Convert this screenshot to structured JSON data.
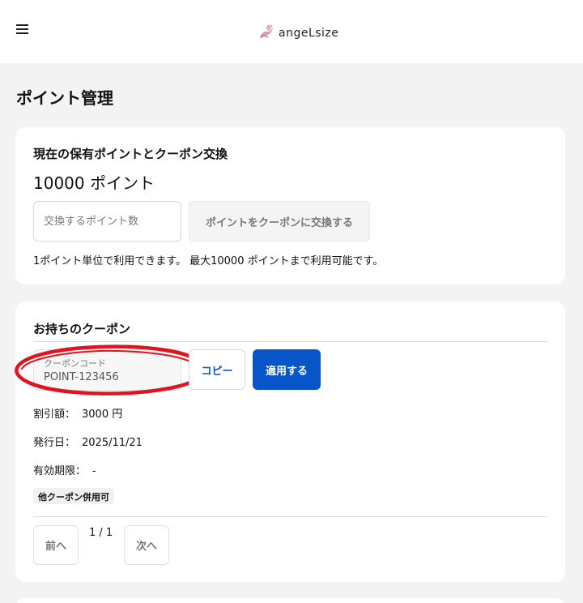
{
  "header": {
    "menu_icon": "hamburger-menu-icon",
    "logo_text": "angeLsize",
    "logo_icon": "angel-logo-icon"
  },
  "page": {
    "title": "ポイント管理"
  },
  "points_card": {
    "title": "現在の保有ポイントとクーポン交換",
    "points_display": "10000 ポイント",
    "input_placeholder": "交換するポイント数",
    "exchange_button": "ポイントをクーポンに交換する",
    "note": "1ポイント単位で利用できます。 最大10000 ポイントまで利用可能です。"
  },
  "coupons_card": {
    "title": "お持ちのクーポン",
    "coupon_code_label": "クーポンコード",
    "coupon_code_value": "POINT-123456",
    "copy_button": "コピー",
    "apply_button": "適用する",
    "discount_label": "割引額：",
    "discount_value": "3000 円",
    "issued_label": "発行日：",
    "issued_value": "2025/11/21",
    "expiry_label": "有効期限：",
    "expiry_value": "-",
    "badge": "他クーポン併用可",
    "pagination": {
      "prev": "前へ",
      "indicator": "1 / 1",
      "next": "次へ"
    },
    "highlight_color": "#e0141e"
  },
  "colors": {
    "primary": "#0755c9",
    "copy_text": "#1556c0",
    "background": "#f3f3f3"
  }
}
